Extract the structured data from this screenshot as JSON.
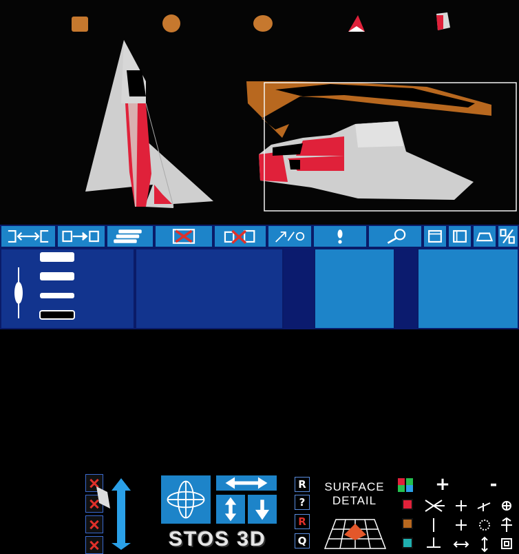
{
  "app": {
    "logo_text": "STOS 3D",
    "surface_label_line1": "SURFACE",
    "surface_label_line2": "DETAIL",
    "side_buttons": [
      "R",
      "?",
      "R",
      "Q"
    ]
  },
  "palette": {
    "accent": "#1d84c9",
    "panel_dark": "#0a1b68",
    "model_red": "#e0213a",
    "model_grey": "#c8c8c8",
    "model_brown": "#c6782e"
  },
  "toolbar_icons": [
    "link-objects-icon",
    "copy-object-icon",
    "stack-layers-icon",
    "delete-object-icon",
    "delete-copy-icon",
    "scale-rotate-icon",
    "light-icon",
    "zoom-icon",
    "view-front-icon",
    "view-side-icon",
    "view-top-icon",
    "percent-icon"
  ],
  "numeric_pad_labels": [
    "+",
    "-"
  ]
}
